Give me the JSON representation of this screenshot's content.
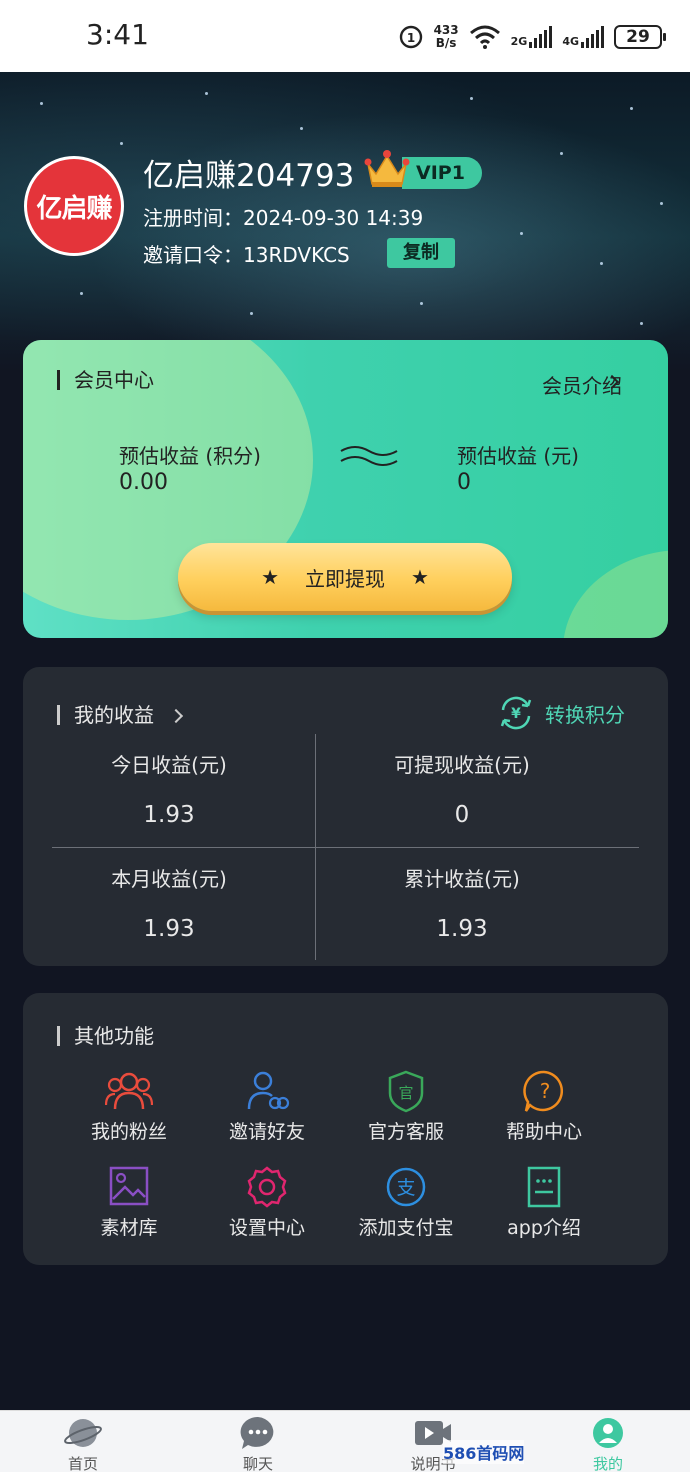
{
  "status_bar": {
    "time": "3:41",
    "net_speed_value": "433",
    "net_speed_unit": "B/s",
    "sim1": "2G",
    "sim2": "4G",
    "battery": "29"
  },
  "profile": {
    "avatar_text": "亿启赚",
    "username": "亿启赚204793",
    "vip": "VIP1",
    "reg_time": "注册时间：2024-09-30 14:39",
    "invite": "邀请口令：13RDVKCS",
    "copy_label": "复制"
  },
  "member_card": {
    "title": "会员中心",
    "intro_link": "会员介绍",
    "points_label": "预估收益 (积分)",
    "points_value": "0.00",
    "yuan_label": "预估收益 (元)",
    "yuan_value": "0",
    "withdraw_label": "立即提现"
  },
  "earnings": {
    "title": "我的收益",
    "convert_label": "转换积分",
    "cells": [
      {
        "label": "今日收益(元)",
        "value": "1.93"
      },
      {
        "label": "可提现收益(元)",
        "value": "0"
      },
      {
        "label": "本月收益(元)",
        "value": "1.93"
      },
      {
        "label": "累计收益(元)",
        "value": "1.93"
      }
    ]
  },
  "other_functions": {
    "title": "其他功能",
    "items": [
      {
        "label": "我的粉丝",
        "icon": "fans-icon",
        "color": "#e94c3d"
      },
      {
        "label": "邀请好友",
        "icon": "invite-friend-icon",
        "color": "#3b7fd9"
      },
      {
        "label": "官方客服",
        "icon": "official-service-icon",
        "color": "#3aa85a"
      },
      {
        "label": "帮助中心",
        "icon": "help-icon",
        "color": "#f08c1e"
      },
      {
        "label": "素材库",
        "icon": "gallery-icon",
        "color": "#8a4fc4"
      },
      {
        "label": "设置中心",
        "icon": "settings-icon",
        "color": "#e0266f"
      },
      {
        "label": "添加支付宝",
        "icon": "alipay-icon",
        "color": "#2d8fe0"
      },
      {
        "label": "app介绍",
        "icon": "app-intro-icon",
        "color": "#3ec8a0"
      }
    ]
  },
  "bottom_nav": {
    "items": [
      {
        "label": "首页",
        "icon": "planet-icon"
      },
      {
        "label": "聊天",
        "icon": "chat-icon"
      },
      {
        "label": "说明书",
        "icon": "video-icon"
      },
      {
        "label": "我的",
        "icon": "profile-icon"
      }
    ]
  },
  "watermark": "586首码网"
}
